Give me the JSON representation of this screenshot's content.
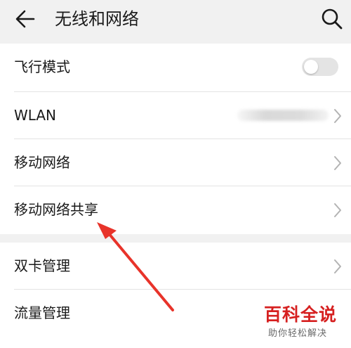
{
  "header": {
    "title": "无线和网络",
    "back_icon": "arrow-left-icon",
    "search_icon": "search-icon"
  },
  "settings": {
    "airplane_mode": {
      "label": "飞行模式",
      "enabled": false
    },
    "wlan": {
      "label": "WLAN"
    },
    "mobile_network": {
      "label": "移动网络"
    },
    "hotspot": {
      "label": "移动网络共享"
    },
    "dual_sim": {
      "label": "双卡管理"
    },
    "data_usage": {
      "label": "流量管理"
    }
  },
  "annotation": {
    "color": "#e8332a",
    "points_to": "hotspot"
  },
  "watermark": {
    "title": "百科全说",
    "subtitle": "助你轻松解决",
    "color": "#d62020"
  }
}
